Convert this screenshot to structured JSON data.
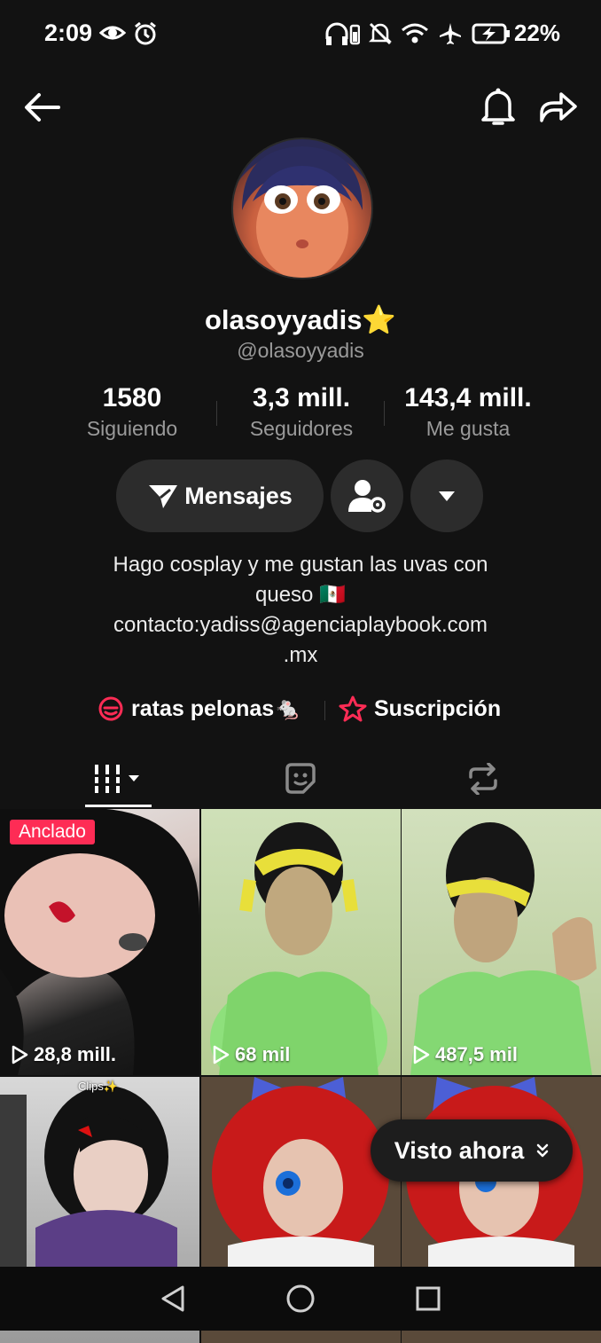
{
  "status_bar": {
    "time": "2:09",
    "battery": "22%"
  },
  "profile": {
    "username": "olasoyyadis⭐",
    "handle": "@olasoyyadis",
    "stats": [
      {
        "value": "1580",
        "label": "Siguiendo"
      },
      {
        "value": "3,3 mill.",
        "label": "Seguidores"
      },
      {
        "value": "143,4 mill.",
        "label": "Me gusta"
      }
    ],
    "message_button": "Mensajes",
    "bio_line1": "Hago cosplay y me gustan las uvas con",
    "bio_line2": "queso  🇲🇽",
    "bio_line3": "contacto:yadiss@agenciaplaybook.com",
    "bio_line4": ".mx",
    "links": [
      {
        "label": "ratas pelonas🐁"
      },
      {
        "label": "Suscripción"
      }
    ]
  },
  "videos": [
    {
      "views": "28,8 mill.",
      "pinned_label": "Anclado"
    },
    {
      "views": "68 mil"
    },
    {
      "views": "487,5 mil"
    },
    {
      "overlay": "Clips✨"
    },
    {},
    {}
  ],
  "visto_ahora": "Visto ahora",
  "colors": {
    "accent": "#fe2c55",
    "background": "#121212"
  }
}
